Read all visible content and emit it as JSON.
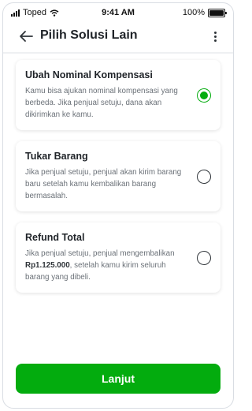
{
  "status_bar": {
    "carrier": "Toped",
    "time": "9:41 AM",
    "battery": "100%"
  },
  "header": {
    "title": "Pilih Solusi Lain"
  },
  "options": [
    {
      "title": "Ubah Nominal Kompensasi",
      "description": "Kamu bisa ajukan nominal kompensasi yang berbeda. Jika penjual setuju, dana akan dikirimkan ke kamu.",
      "selected": true
    },
    {
      "title": "Tukar Barang",
      "description": "Jika penjual setuju, penjual akan kirim barang baru setelah kamu kembalikan barang bermasalah.",
      "selected": false
    },
    {
      "title": "Refund Total",
      "description_before": "Jika penjual setuju, penjual mengembalikan",
      "amount": "Rp1.125.000",
      "description_after": ", setelah kamu kirim seluruh barang yang dibeli.",
      "selected": false
    }
  ],
  "cta": {
    "label": "Lanjut"
  },
  "colors": {
    "accent": "#03AC0E",
    "text": "#1F2328",
    "muted": "#6B7178"
  },
  "icons": {
    "back": "arrow-left-icon",
    "menu": "more-vertical-icon"
  }
}
